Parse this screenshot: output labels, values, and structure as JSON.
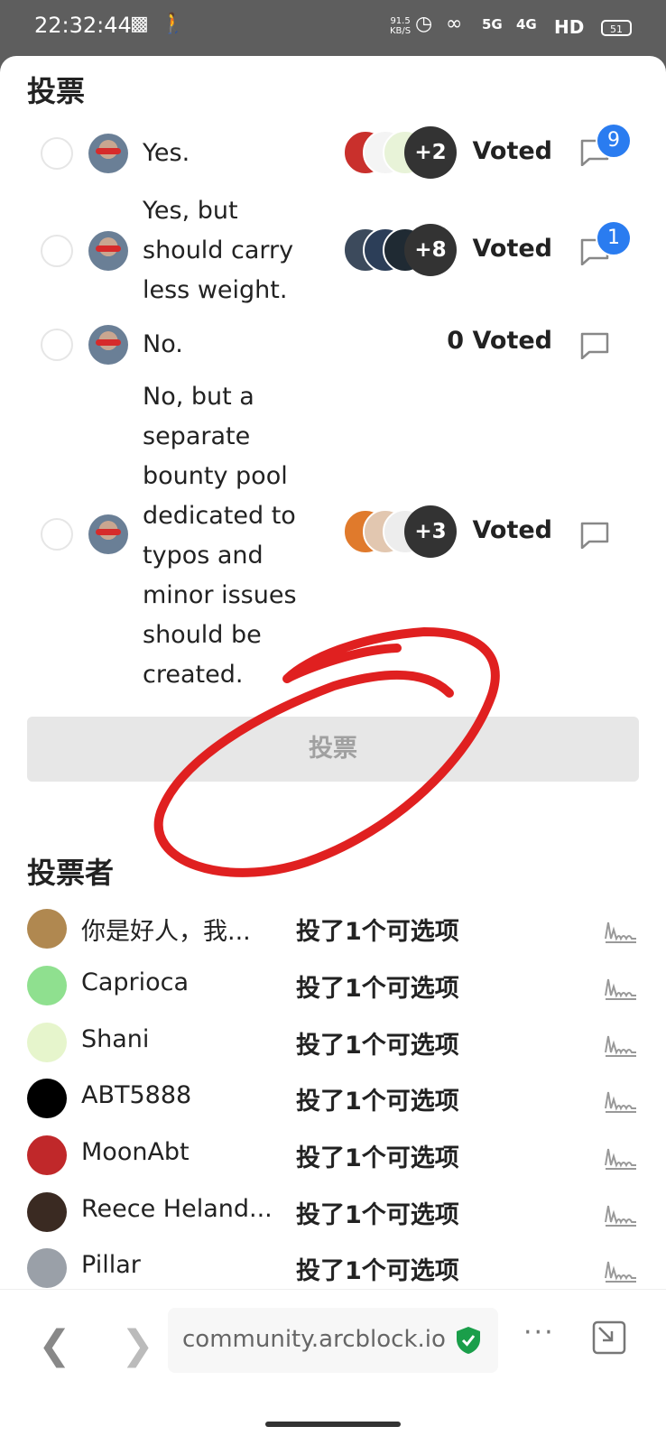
{
  "status_bar": {
    "time": "22:32:44",
    "net_speed_value": "91.5",
    "net_speed_unit": "KB/S",
    "sig1": "5G",
    "sig2": "4G",
    "hd": "HD",
    "battery": "51"
  },
  "poll": {
    "title": "投票",
    "options": [
      {
        "label": "Yes.",
        "extra": "+2",
        "voted": "Voted",
        "comments": "9"
      },
      {
        "label": "Yes, but should carry less weight.",
        "extra": "+8",
        "voted": "Voted",
        "comments": "1"
      },
      {
        "label": "No.",
        "extra": "",
        "voted": "0 Voted",
        "comments": ""
      },
      {
        "label": "No, but a separate bounty pool dedicated to typos and minor issues should be created.",
        "extra": "+3",
        "voted": "Voted",
        "comments": ""
      }
    ],
    "vote_button": "投票"
  },
  "voters": {
    "title": "投票者",
    "items": [
      {
        "name": "你是好人，我...",
        "status": "投了1个可选项",
        "avatar_color": "#b08850"
      },
      {
        "name": "Caprioca",
        "status": "投了1个可选项",
        "avatar_color": "#8fe08f"
      },
      {
        "name": "Shani",
        "status": "投了1个可选项",
        "avatar_color": "#e6f5cc"
      },
      {
        "name": "ABT5888",
        "status": "投了1个可选项",
        "avatar_color": "#000000"
      },
      {
        "name": "MoonAbt",
        "status": "投了1个可选项",
        "avatar_color": "#c0282a"
      },
      {
        "name": "Reece Heland...",
        "status": "投了1个可选项",
        "avatar_color": "#3a2a22"
      },
      {
        "name": "Pillar",
        "status": "投了1个可选项",
        "avatar_color": "#9aa0a8"
      }
    ]
  },
  "browser": {
    "url": "community.arcblock.io",
    "more": "···"
  },
  "colors": {
    "accent_blue": "#2a7cf0",
    "annotation_red": "#e02020",
    "secure_green": "#1a9e4a"
  }
}
